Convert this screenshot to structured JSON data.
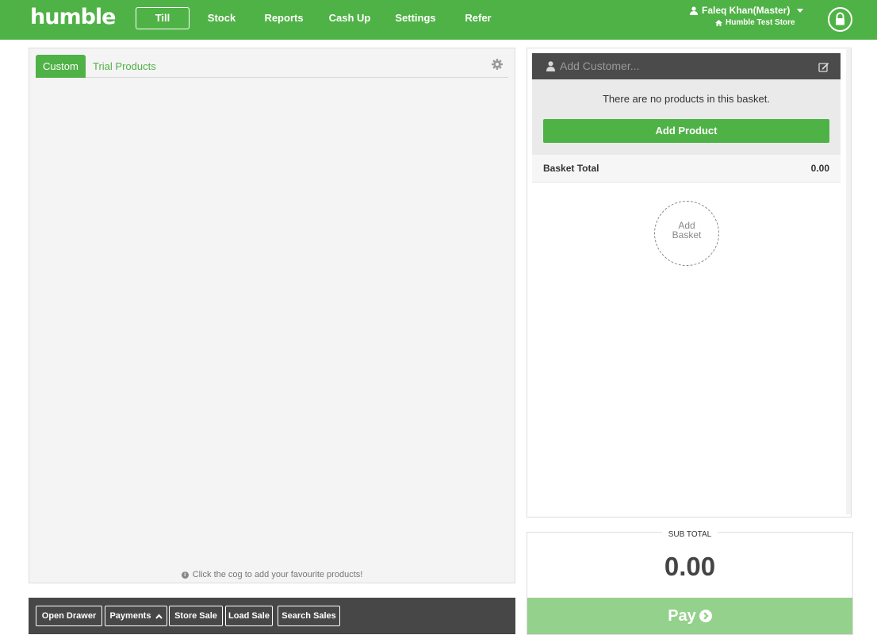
{
  "brand": {
    "logo": "humble"
  },
  "nav": {
    "items": [
      "Till",
      "Stock",
      "Reports",
      "Cash Up",
      "Settings",
      "Refer"
    ],
    "active": "Till"
  },
  "user": {
    "name": "Faleq Khan(Master)",
    "store": "Humble Test Store"
  },
  "products_panel": {
    "tabs": [
      "Custom",
      "Trial Products"
    ],
    "active_tab": "Custom",
    "hint": "Click the cog to add your favourite products!"
  },
  "actions": {
    "open_drawer": "Open Drawer",
    "payments": "Payments",
    "store_sale": "Store Sale",
    "load_sale": "Load Sale",
    "search_sales": "Search Sales"
  },
  "basket": {
    "customer_placeholder": "Add Customer...",
    "empty_message": "There are no products in this basket.",
    "add_product": "Add Product",
    "total_label": "Basket Total",
    "total_value": "0.00",
    "add_basket_line1": "Add",
    "add_basket_line2": "Basket"
  },
  "checkout": {
    "subtotal_label": "SUB TOTAL",
    "subtotal_value": "0.00",
    "pay_label": "Pay"
  },
  "colors": {
    "brand_green": "#4fb246",
    "pay_green_disabled": "#94d18c",
    "dark_bar": "#474747"
  }
}
